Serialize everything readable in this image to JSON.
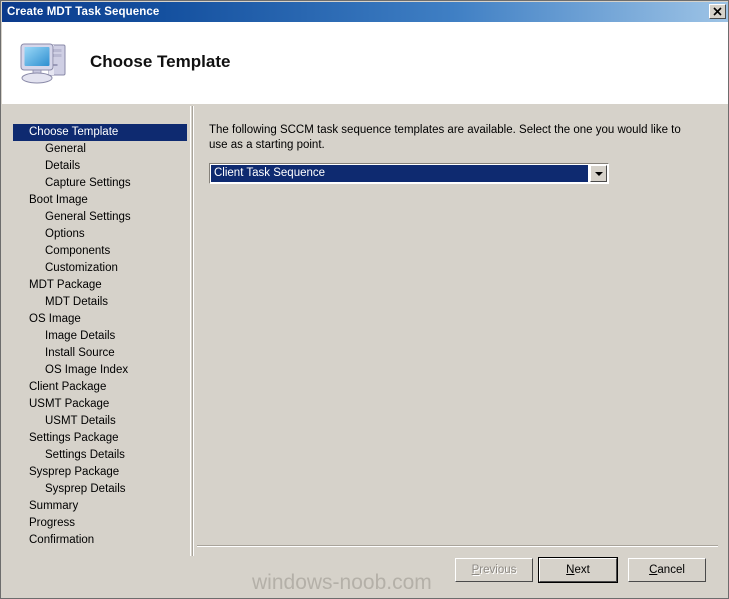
{
  "window": {
    "title": "Create MDT Task Sequence",
    "close_label": "✕",
    "close_icon": "close-icon"
  },
  "header": {
    "icon": "computer-icon",
    "title": "Choose Template"
  },
  "sidebar": {
    "items": [
      {
        "label": "Choose Template",
        "indent": false,
        "selected": true
      },
      {
        "label": "General",
        "indent": true,
        "selected": false
      },
      {
        "label": "Details",
        "indent": true,
        "selected": false
      },
      {
        "label": "Capture Settings",
        "indent": true,
        "selected": false
      },
      {
        "label": "Boot Image",
        "indent": false,
        "selected": false
      },
      {
        "label": "General Settings",
        "indent": true,
        "selected": false
      },
      {
        "label": "Options",
        "indent": true,
        "selected": false
      },
      {
        "label": "Components",
        "indent": true,
        "selected": false
      },
      {
        "label": "Customization",
        "indent": true,
        "selected": false
      },
      {
        "label": "MDT Package",
        "indent": false,
        "selected": false
      },
      {
        "label": "MDT Details",
        "indent": true,
        "selected": false
      },
      {
        "label": "OS Image",
        "indent": false,
        "selected": false
      },
      {
        "label": "Image Details",
        "indent": true,
        "selected": false
      },
      {
        "label": "Install Source",
        "indent": true,
        "selected": false
      },
      {
        "label": "OS Image Index",
        "indent": true,
        "selected": false
      },
      {
        "label": "Client Package",
        "indent": false,
        "selected": false
      },
      {
        "label": "USMT Package",
        "indent": false,
        "selected": false
      },
      {
        "label": "USMT Details",
        "indent": true,
        "selected": false
      },
      {
        "label": "Settings Package",
        "indent": false,
        "selected": false
      },
      {
        "label": "Settings Details",
        "indent": true,
        "selected": false
      },
      {
        "label": "Sysprep Package",
        "indent": false,
        "selected": false
      },
      {
        "label": "Sysprep Details",
        "indent": true,
        "selected": false
      },
      {
        "label": "Summary",
        "indent": false,
        "selected": false
      },
      {
        "label": "Progress",
        "indent": false,
        "selected": false
      },
      {
        "label": "Confirmation",
        "indent": false,
        "selected": false
      }
    ]
  },
  "content": {
    "instruction": "The following SCCM task sequence templates are available.  Select the one you would like to use as a starting point.",
    "template_select": {
      "value": "Client Task Sequence",
      "arrow_icon": "chevron-down-icon",
      "options": [
        "Client Task Sequence"
      ]
    }
  },
  "footer": {
    "previous": {
      "label": "Previous",
      "accel": "P",
      "disabled": true
    },
    "next": {
      "label": "Next",
      "accel": "N",
      "default": true
    },
    "cancel": {
      "label": "Cancel",
      "accel": "C",
      "default": false
    }
  },
  "watermark": "windows-noob.com",
  "colors": {
    "titlebar_start": "#0b3a8c",
    "titlebar_end": "#9ec4e6",
    "dialog_face": "#d6d2ca",
    "selection": "#0e2a70",
    "selection_text": "#ffffff",
    "watermark": "#b4b0a8"
  }
}
